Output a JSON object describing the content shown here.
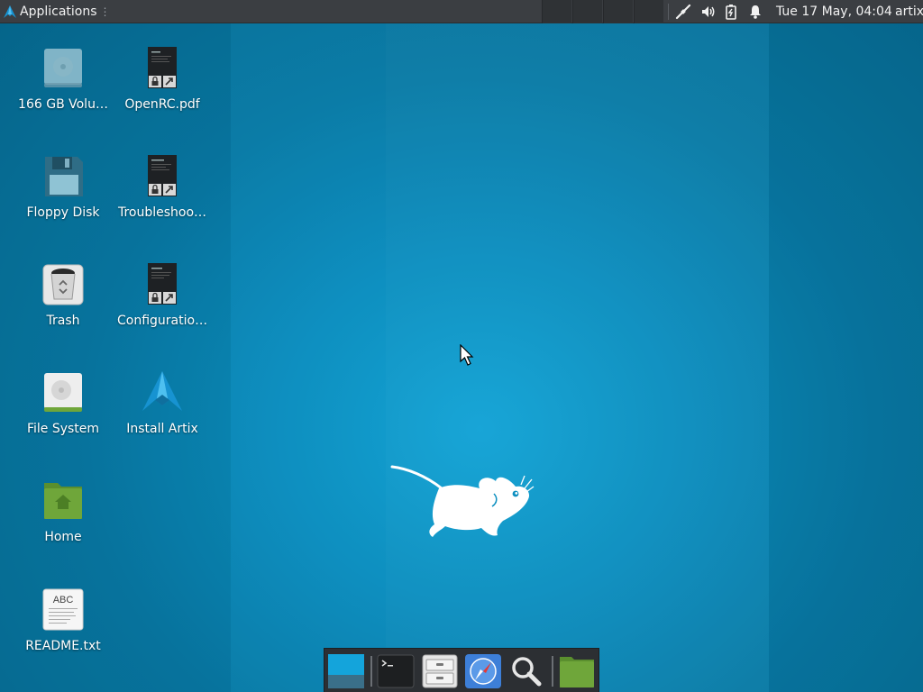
{
  "top_panel": {
    "applications_label": "Applications",
    "clock": "Tue 17 May, 04:04",
    "user": "artix",
    "tray_icons": [
      "network-wired-icon",
      "volume-icon",
      "battery-icon",
      "notification-bell-icon"
    ]
  },
  "desktop": {
    "icons": [
      {
        "label": "166 GB Volu…",
        "icon": "drive-icon"
      },
      {
        "label": "OpenRC.pdf",
        "icon": "pdf-document-icon"
      },
      {
        "label": "Floppy Disk",
        "icon": "floppy-disk-icon"
      },
      {
        "label": "Troubleshoo…",
        "icon": "document-icon"
      },
      {
        "label": "Trash",
        "icon": "trash-icon"
      },
      {
        "label": "Configuratio…",
        "icon": "document-icon"
      },
      {
        "label": "File System",
        "icon": "harddisk-icon"
      },
      {
        "label": "Install Artix",
        "icon": "artix-logo-icon"
      },
      {
        "label": "Home",
        "icon": "home-folder-icon"
      },
      {
        "label": "README.txt",
        "icon": "text-file-icon"
      }
    ],
    "readme_preview_text": "ABC"
  },
  "dock": {
    "items": [
      "show-desktop-icon",
      "terminal-icon",
      "file-manager-icon",
      "web-browser-icon",
      "search-icon",
      "folder-icon"
    ]
  },
  "colors": {
    "panel": "#3b3e42",
    "wallpaper": "#0b8fc0",
    "folder_green": "#6fa63a"
  }
}
